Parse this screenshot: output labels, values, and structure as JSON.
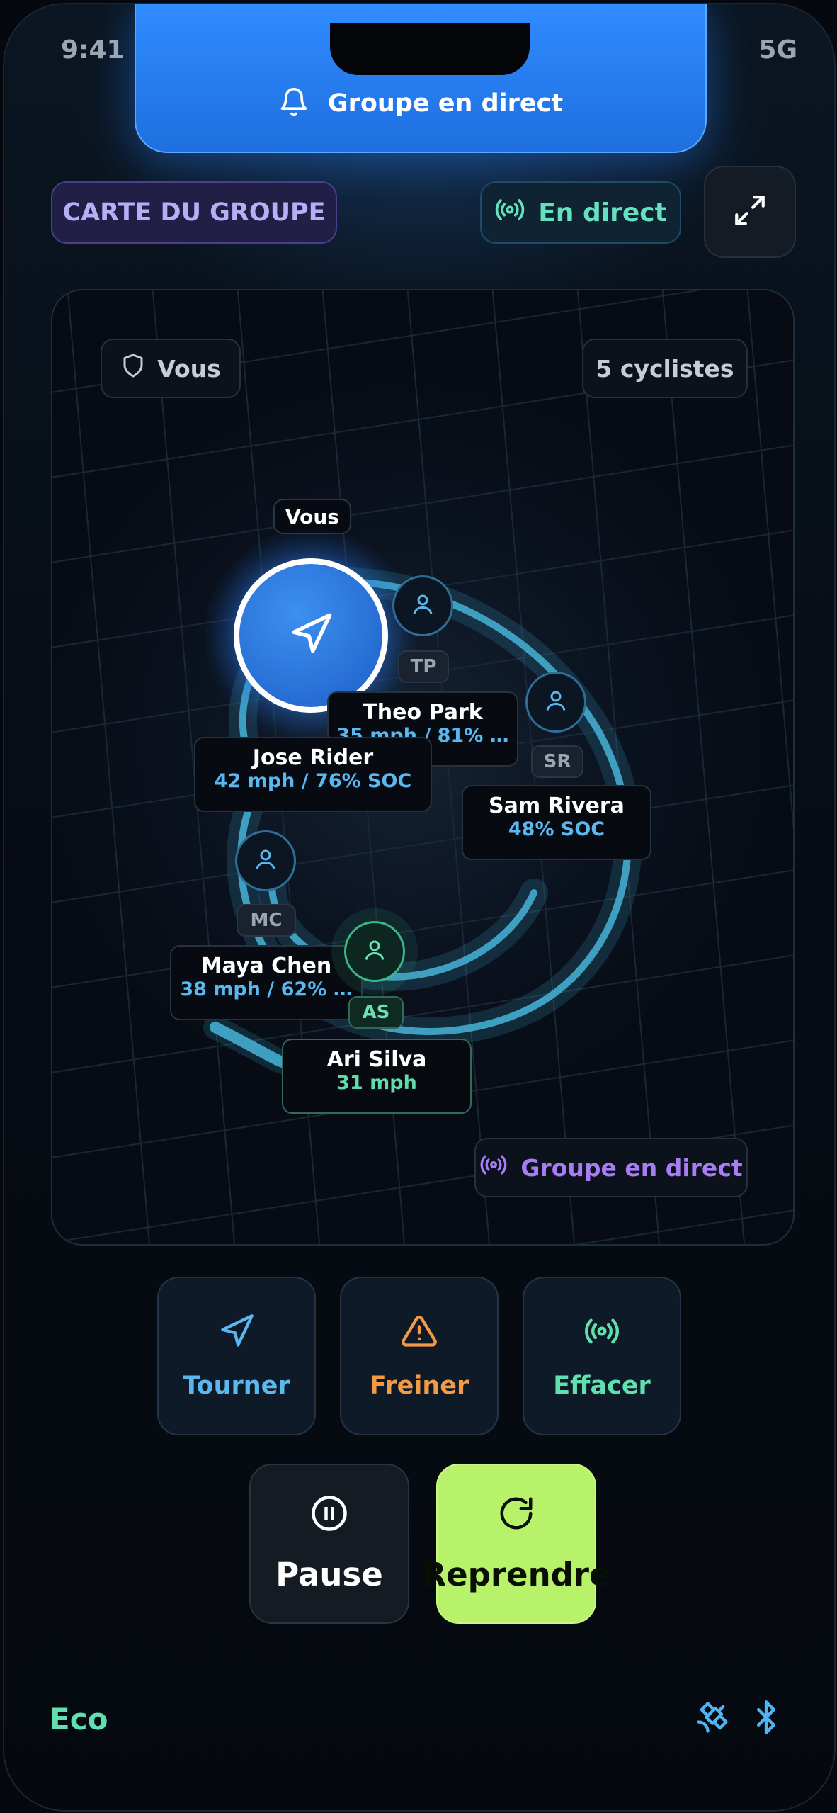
{
  "status_bar": {
    "time": "9:41",
    "network": "5G"
  },
  "banner": {
    "label": "Groupe en direct",
    "icon": "bell-icon"
  },
  "header": {
    "map_title": "CARTE DU GROUPE",
    "live_label": "En direct",
    "live_icon": "broadcast-icon",
    "expand_icon": "expand-icon"
  },
  "map": {
    "you_chip": "Vous",
    "rider_count": "5 cyclistes",
    "me_tag": "Vous",
    "live_group_chip": "Groupe en direct",
    "riders": [
      {
        "name": "Jose Rider",
        "stats": "42 mph / 76% SOC",
        "self": true
      },
      {
        "initials": "TP",
        "name": "Theo Park",
        "stats": "35 mph / 81% …"
      },
      {
        "initials": "SR",
        "name": "Sam Rivera",
        "stats": "48% SOC"
      },
      {
        "initials": "MC",
        "name": "Maya Chen",
        "stats": "38 mph / 62% …"
      },
      {
        "initials": "AS",
        "name": "Ari Silva",
        "stats": "31 mph",
        "highlight": true
      }
    ]
  },
  "actions": [
    {
      "label": "Tourner",
      "icon": "navigation-arrow-icon",
      "color": "#5bb8ef"
    },
    {
      "label": "Freiner",
      "icon": "warning-triangle-icon",
      "color": "#f29a44"
    },
    {
      "label": "Effacer",
      "icon": "broadcast-icon",
      "color": "#5fe0ae"
    }
  ],
  "controls": {
    "pause_label": "Pause",
    "resume_label": "Reprendre"
  },
  "footer": {
    "mode": "Eco",
    "icons": [
      "satellite-icon",
      "bluetooth-icon"
    ]
  },
  "colors": {
    "accent_blue": "#2f8cff",
    "accent_green": "#b8f26a",
    "live_teal": "#63e2bd",
    "purple": "#a77cf5"
  }
}
